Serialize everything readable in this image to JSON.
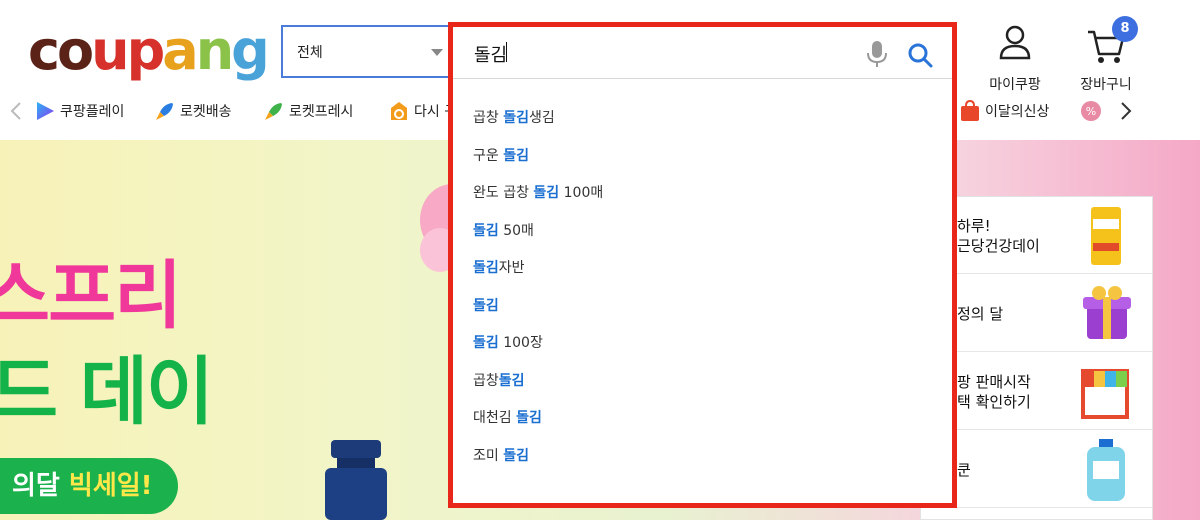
{
  "header": {
    "logo_letters": [
      {
        "ch": "c",
        "color": "#5b2217"
      },
      {
        "ch": "o",
        "color": "#5b2217"
      },
      {
        "ch": "u",
        "color": "#d6322b"
      },
      {
        "ch": "p",
        "color": "#d6322b"
      },
      {
        "ch": "a",
        "color": "#e8a11c"
      },
      {
        "ch": "n",
        "color": "#8bc34a"
      },
      {
        "ch": "g",
        "color": "#4aa3d8"
      }
    ],
    "category_label": "전체",
    "account_label": "마이쿠팡",
    "cart_label": "장바구니",
    "cart_count": "8"
  },
  "search": {
    "value": "돌김",
    "suggestions": [
      {
        "before": "곱창 ",
        "kw": "돌김",
        "after": "생김"
      },
      {
        "before": "구운 ",
        "kw": "돌김",
        "after": ""
      },
      {
        "before": "완도 곱창 ",
        "kw": "돌김",
        "after": " 100매"
      },
      {
        "before": "",
        "kw": "돌김",
        "after": " 50매"
      },
      {
        "before": "",
        "kw": "돌김",
        "after": "자반"
      },
      {
        "before": "",
        "kw": "돌김",
        "after": ""
      },
      {
        "before": "",
        "kw": "돌김",
        "after": " 100장"
      },
      {
        "before": "곱창",
        "kw": "돌김",
        "after": ""
      },
      {
        "before": "대천김 ",
        "kw": "돌김",
        "after": ""
      },
      {
        "before": "조미 ",
        "kw": "돌김",
        "after": ""
      }
    ]
  },
  "nav": {
    "items": [
      {
        "label": "쿠팡플레이",
        "icon": "play-icon"
      },
      {
        "label": "로켓배송",
        "icon": "rocket-icon"
      },
      {
        "label": "로켓프레시",
        "icon": "rocket-fresh-icon"
      },
      {
        "label": "다시 구",
        "icon": "reorder-icon"
      },
      {
        "label": "이달의신상",
        "icon": "new-icon"
      }
    ]
  },
  "banner": {
    "line1": "스프리",
    "line2": "드 데이",
    "pill_pre": "의달 ",
    "pill_hl": "빅세일!"
  },
  "side_panel": {
    "items": [
      {
        "line1": "하루!",
        "line2": "근당건강데이"
      },
      {
        "line1": "정의 달",
        "line2": ""
      },
      {
        "line1": "팡 판매시작",
        "line2": "택 확인하기"
      },
      {
        "line1": "쿤",
        "line2": ""
      }
    ]
  },
  "colors": {
    "accent_blue": "#1a6fd1",
    "search_border": "#e8261a",
    "badge_blue": "#3e6fe0"
  }
}
